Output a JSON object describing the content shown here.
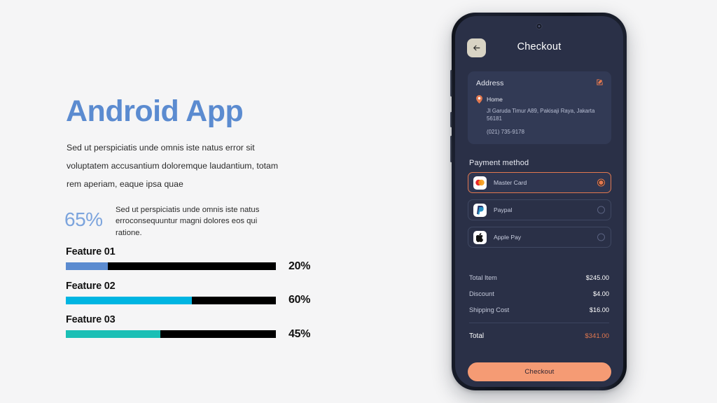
{
  "slide": {
    "background_color": "#f5f5f6",
    "title": "Android App",
    "title_color": "#5b8bd0",
    "intro_paragraph": "Sed ut perspiciatis unde omnis iste natus error sit voluptatem accusantium doloremque laudantium, totam rem aperiam, eaque ipsa quae"
  },
  "stat": {
    "value": "65%",
    "value_color": "#7ca4dd",
    "text": "Sed ut perspiciatis unde omnis iste natus erroconsequuntur magni dolores eos qui ratione."
  },
  "chart_data": {
    "type": "bar",
    "title": "",
    "orientation": "horizontal",
    "categories": [
      "Feature 01",
      "Feature 02",
      "Feature 03"
    ],
    "values": [
      20,
      60,
      45
    ],
    "value_labels": [
      "20%",
      "60%",
      "45%"
    ],
    "series": [
      {
        "name": "Feature 01",
        "value": 20,
        "label": "20%",
        "color": "#5b8bd0"
      },
      {
        "name": "Feature 02",
        "value": 60,
        "label": "60%",
        "color": "#00b5e2"
      },
      {
        "name": "Feature 03",
        "value": 45,
        "label": "45%",
        "color": "#1abfb5"
      }
    ],
    "track_color": "#000000",
    "xlabel": "",
    "ylabel": "",
    "xlim": [
      0,
      100
    ],
    "grid": false,
    "legend": "none"
  },
  "phone": {
    "header": {
      "back_icon": "arrow-left-icon",
      "title": "Checkout"
    },
    "address": {
      "heading": "Address",
      "edit_icon": "edit-pencil-icon",
      "pin_icon": "location-pin-icon",
      "label": "Home",
      "lines": "Jl Garuda Timur A89, Pakisaji Raya, Jakarta 56181",
      "phone": "(021) 735-9178"
    },
    "payment": {
      "heading": "Payment method",
      "options": [
        {
          "name": "Master Card",
          "icon": "mastercard-icon",
          "selected": true
        },
        {
          "name": "Paypal",
          "icon": "paypal-icon",
          "selected": false
        },
        {
          "name": "Apple Pay",
          "icon": "apple-pay-icon",
          "selected": false
        }
      ]
    },
    "summary": {
      "rows": [
        {
          "label": "Total Item",
          "value": "$245.00"
        },
        {
          "label": "Discount",
          "value": "$4.00"
        },
        {
          "label": "Shipping Cost",
          "value": "$16.00"
        }
      ],
      "total_label": "Total",
      "total_value": "$341.00",
      "total_color": "#e2784f"
    },
    "checkout_button": {
      "label": "Checkout",
      "color": "#f59b74"
    }
  }
}
